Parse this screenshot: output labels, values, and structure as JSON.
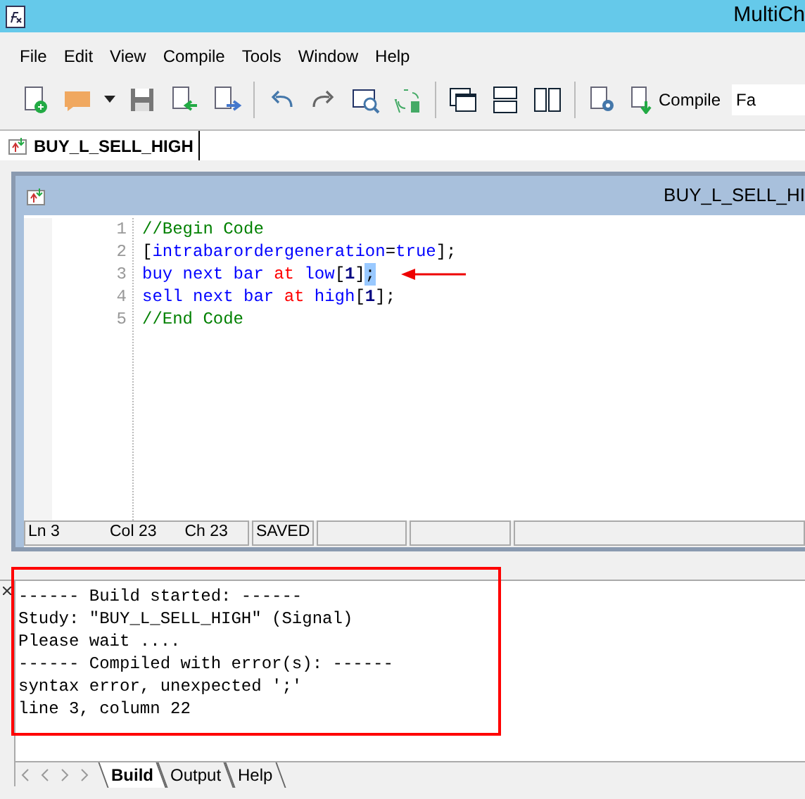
{
  "window": {
    "title": "MultiCh"
  },
  "menu": [
    "File",
    "Edit",
    "View",
    "Compile",
    "Tools",
    "Window",
    "Help"
  ],
  "toolbar": {
    "compile_label": "Compile",
    "field_value": "Fa"
  },
  "document_tab": {
    "label": "BUY_L_SELL_HIGH",
    "selected": true
  },
  "editor": {
    "title": "BUY_L_SELL_HI",
    "lines": [
      {
        "number": "1",
        "tokens": [
          {
            "text": "//Begin Code",
            "kind": "comment"
          }
        ]
      },
      {
        "number": "2",
        "tokens": [
          {
            "text": "[",
            "kind": "punct"
          },
          {
            "text": "intrabarordergeneration",
            "kind": "keyword"
          },
          {
            "text": "=",
            "kind": "punct"
          },
          {
            "text": "true",
            "kind": "keyword"
          },
          {
            "text": "];",
            "kind": "punct"
          }
        ]
      },
      {
        "number": "3",
        "tokens": [
          {
            "text": "buy next bar",
            "kind": "keyword"
          },
          {
            "text": "at",
            "kind": "reserved",
            "gap": true
          },
          {
            "text": "low",
            "kind": "keyword",
            "gap": true
          },
          {
            "text": "[",
            "kind": "punct"
          },
          {
            "text": "1",
            "kind": "number"
          },
          {
            "text": "]",
            "kind": "punct"
          },
          {
            "text": ";",
            "kind": "punct",
            "highlighted": true
          }
        ],
        "arrow": true
      },
      {
        "number": "4",
        "tokens": [
          {
            "text": "sell next bar",
            "kind": "keyword"
          },
          {
            "text": "at",
            "kind": "reserved",
            "gap": true
          },
          {
            "text": "high",
            "kind": "keyword",
            "gap": true
          },
          {
            "text": "[",
            "kind": "punct"
          },
          {
            "text": "1",
            "kind": "number"
          },
          {
            "text": "];",
            "kind": "punct"
          }
        ]
      },
      {
        "number": "5",
        "tokens": [
          {
            "text": "//End Code",
            "kind": "comment"
          }
        ]
      }
    ],
    "status": [
      "Ln 3",
      "Col 23",
      "Ch 23",
      "SAVED"
    ]
  },
  "output": {
    "lines": [
      "------ Build started: ------",
      "Study: \"BUY_L_SELL_HIGH\" (Signal)",
      "Please wait ....",
      "------ Compiled with error(s): ------",
      "syntax error, unexpected ';'",
      "line 3, column 22"
    ],
    "tabs": [
      {
        "label": "Build",
        "selected": true
      },
      {
        "label": "Output",
        "selected": false
      },
      {
        "label": "Help",
        "selected": false
      }
    ]
  }
}
